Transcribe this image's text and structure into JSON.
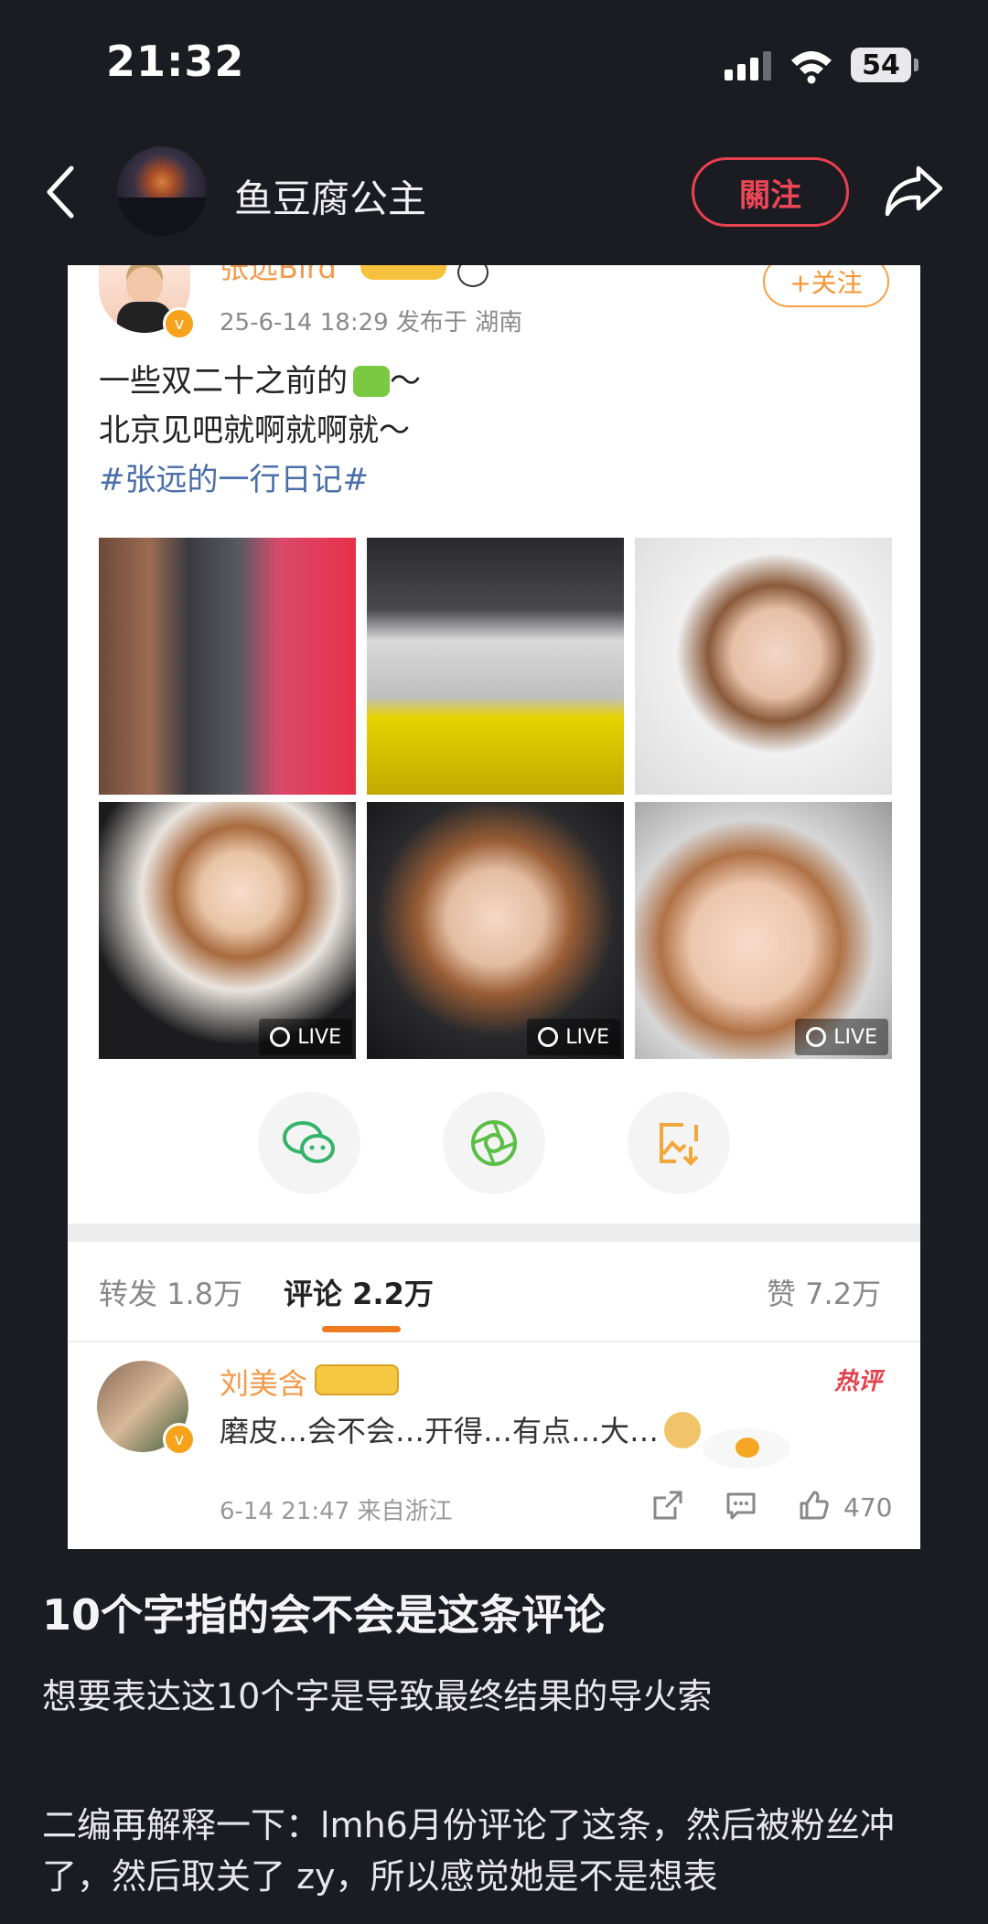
{
  "status": {
    "time": "21:32",
    "battery": "54"
  },
  "header": {
    "username": "鱼豆腐公主",
    "follow_label": "關注"
  },
  "post": {
    "author": "张远Bird",
    "follow_label": "+关注",
    "meta": "25-6-14 18:29  发布于 湖南",
    "line1": "一些双二十之前的",
    "line1_suffix": "～",
    "line2": "北京见吧就啊就啊就～",
    "hashtag": "#张远的一行日记#",
    "live_label": "LIVE",
    "share_icons": [
      "wechat-icon",
      "moments-icon",
      "save-image-icon"
    ]
  },
  "tabs": {
    "repost": "转发 1.8万",
    "comments": "评论 2.2万",
    "likes": "赞 7.2万"
  },
  "comment": {
    "author": "刘美含",
    "hot_label": "热评",
    "text": "磨皮…会不会…开得…有点…大…",
    "meta": "6-14 21:47  来自浙江",
    "like_count": "470"
  },
  "caption": {
    "title": "10个字指的会不会是这条评论",
    "para1": "想要表达这10个字是导致最终结果的导火索",
    "para2": "二编再解释一下：lmh6月份评论了这条，然后被粉丝冲了，然后取关了 zy，所以感觉她是不是想表"
  },
  "colors": {
    "follow_red": "#e8414f",
    "orange": "#f39a4a",
    "background": "#1b1b22"
  }
}
